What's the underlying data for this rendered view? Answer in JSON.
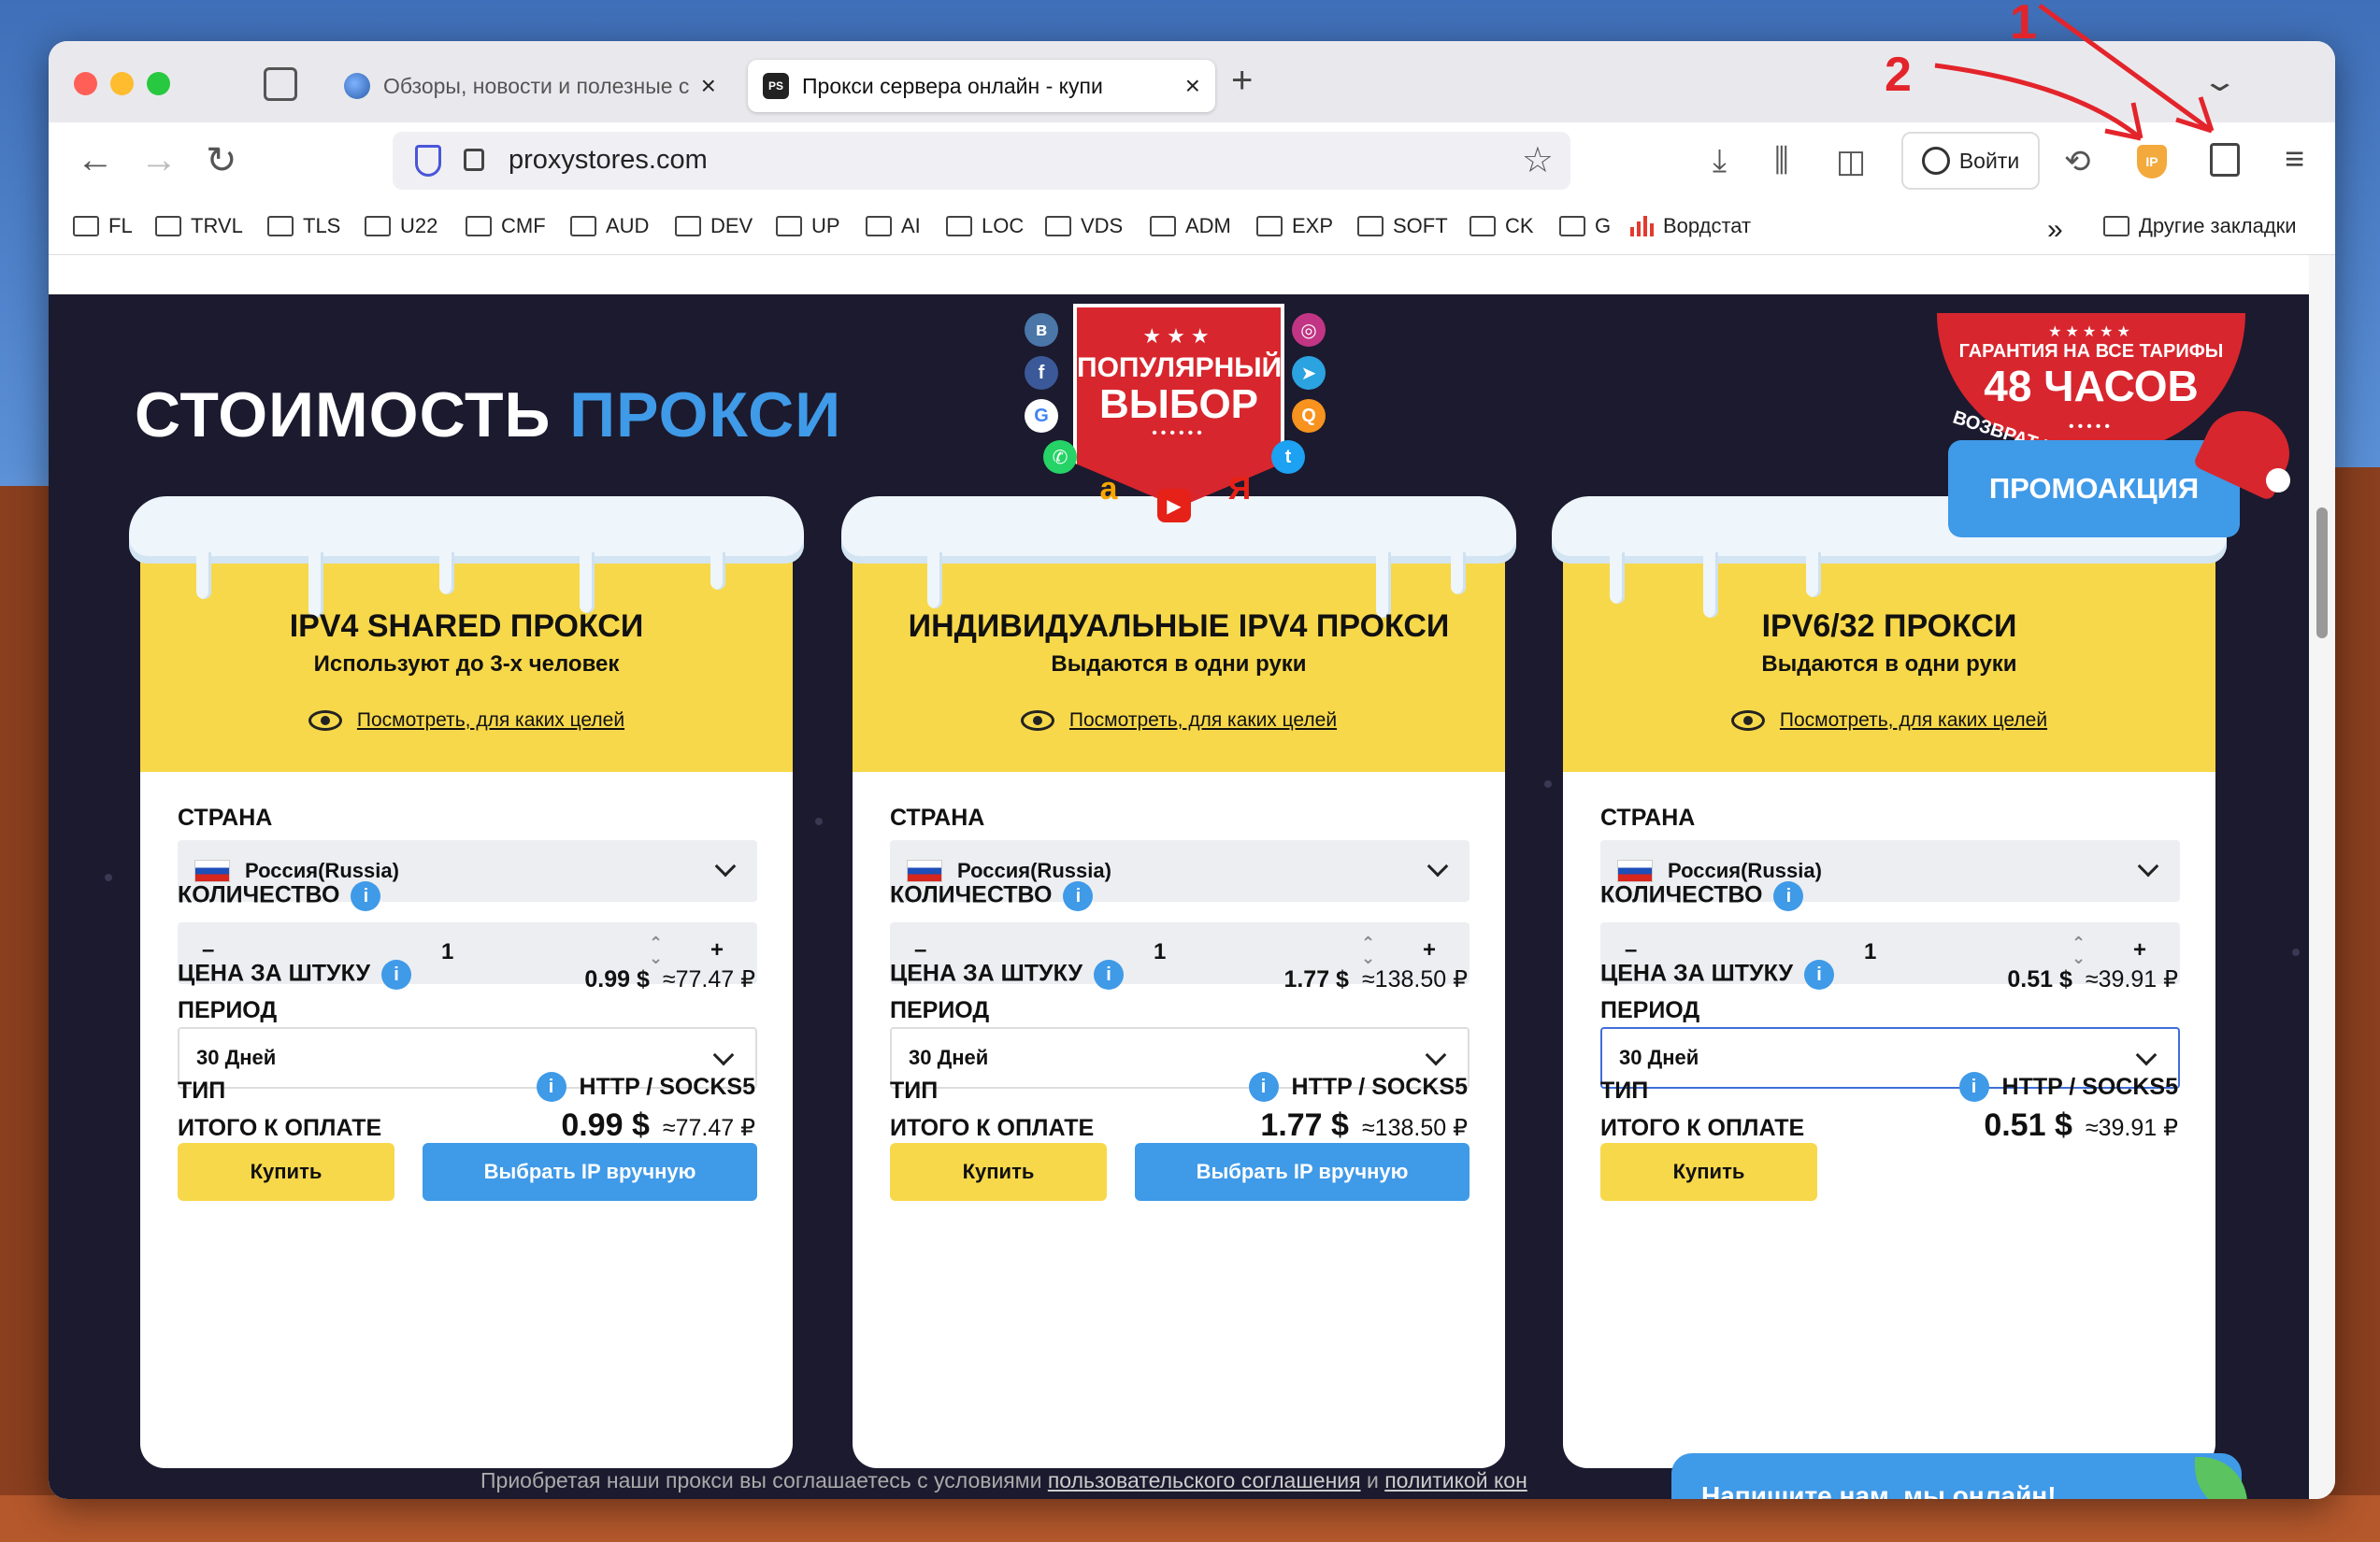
{
  "browser": {
    "tabs": [
      {
        "label": "Обзоры, новости и полезные с",
        "active": false
      },
      {
        "label": "Прокси сервера онлайн - купи",
        "active": true,
        "favicon_text": "PS"
      }
    ],
    "url": "proxystores.com",
    "login_label": "Войти",
    "ext_ip_label": "IP"
  },
  "bookmarks": {
    "items": [
      "FL",
      "TRVL",
      "TLS",
      "U22",
      "CMF",
      "AUD",
      "DEV",
      "UP",
      "AI",
      "LOC",
      "VDS",
      "ADM",
      "EXP",
      "SOFT",
      "CK",
      "G"
    ],
    "wordstat": "Вордстат",
    "other": "Другие закладки"
  },
  "page": {
    "headline_white": "СТОИМОСТЬ",
    "headline_blue": "ПРОКСИ",
    "ribbon": {
      "stars": "★★★",
      "line1": "ПОПУЛЯРНЫЙ",
      "line2": "ВЫБОР",
      "dots": "••••••"
    },
    "badge": {
      "stars": "★★★★★",
      "line1": "ГАРАНТИЯ НА ВСЕ ТАРИФЫ",
      "line2": "48 ЧАСОВ",
      "dots": "•••••",
      "arc": "ВОЗВРАТ И/ИЛИ ЗАМЕНА IP"
    },
    "promo_label": "ПРОМОАКЦИЯ",
    "labels": {
      "country": "СТРАНА",
      "quantity": "КОЛИЧЕСТВО",
      "unit_price": "ЦЕНА ЗА ШТУКУ",
      "period": "ПЕРИОД",
      "type": "ТИП",
      "total": "ИТОГО К ОПЛАТЕ",
      "view_link": "Посмотреть, для каких целей",
      "buy": "Купить",
      "choose_ip": "Выбрать IP вручную",
      "info": "i"
    },
    "cards": [
      {
        "title": "IPV4 SHARED ПРОКСИ",
        "subtitle": "Используют до 3-х человек",
        "country": "Россия(Russia)",
        "qty": "1",
        "price_usd": "0.99 $",
        "price_rub": "≈77.47 ₽",
        "period": "30 Дней",
        "type": "HTTP / SOCKS5",
        "total_usd": "0.99 $",
        "total_rub": "≈77.47 ₽"
      },
      {
        "title": "ИНДИВИДУАЛЬНЫЕ IPV4 ПРОКСИ",
        "subtitle": "Выдаются в одни руки",
        "country": "Россия(Russia)",
        "qty": "1",
        "price_usd": "1.77 $",
        "price_rub": "≈138.50 ₽",
        "period": "30 Дней",
        "type": "HTTP / SOCKS5",
        "total_usd": "1.77 $",
        "total_rub": "≈138.50 ₽"
      },
      {
        "title": "IPV6/32 ПРОКСИ",
        "subtitle": "Выдаются в одни руки",
        "country": "Россия(Russia)",
        "qty": "1",
        "price_usd": "0.51 $",
        "price_rub": "≈39.91 ₽",
        "period": "30 Дней",
        "type": "HTTP / SOCKS5",
        "total_usd": "0.51 $",
        "total_rub": "≈39.91 ₽"
      }
    ],
    "footer": {
      "text": "Приобретая наши прокси вы соглашаетесь с условиями",
      "link1": "пользовательского соглашения",
      "and": "и",
      "link2": "политикой кон"
    },
    "chat_label": "Напишите нам, мы онлайн!"
  },
  "annotations": {
    "one": "1",
    "two": "2"
  },
  "colors": {
    "accent_yellow": "#f7d84a",
    "accent_blue": "#3f9ae8",
    "dark_bg": "#1c1a2e",
    "red": "#d8262e"
  }
}
